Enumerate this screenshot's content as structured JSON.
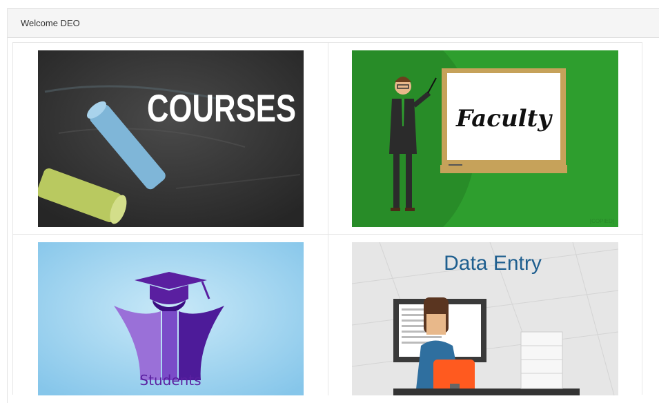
{
  "header": {
    "welcome_text": "Welcome DEO"
  },
  "tiles": [
    {
      "label": "COURSES",
      "icon": "chalk-icon",
      "bg": "#3a3a3a"
    },
    {
      "label": "Faculty",
      "icon": "teacher-icon",
      "bg": "#2ea02e",
      "watermark": "[COPIED]"
    },
    {
      "label": "Students",
      "icon": "graduation-cap-icon",
      "bg": "#9ed3ef"
    },
    {
      "label": "Data Entry",
      "icon": "computer-user-icon",
      "bg": "#e9e9e9"
    }
  ]
}
